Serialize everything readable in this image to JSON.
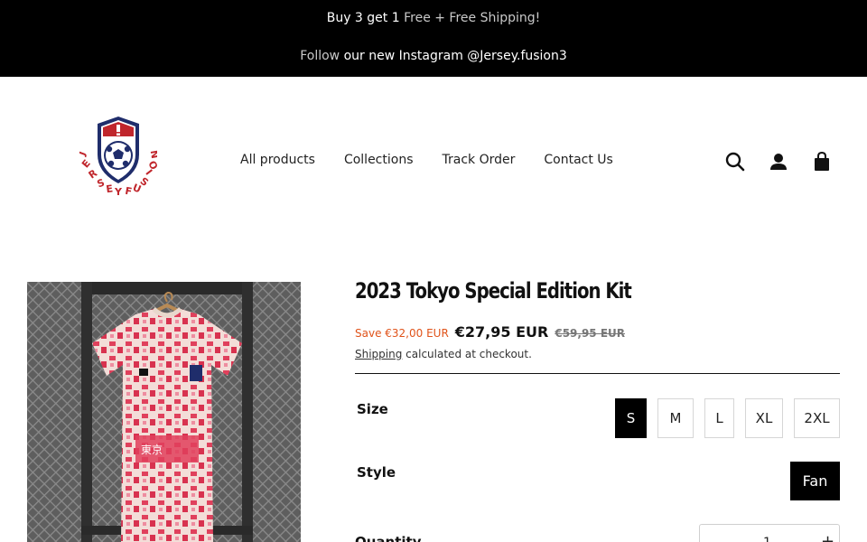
{
  "announcement": {
    "line1": {
      "a": "Buy 3 get 1 ",
      "b": "Free + Free Shipping!"
    },
    "line2": {
      "a": "Follow ",
      "b": "our new Instagram @Jersey.fusion3"
    }
  },
  "logo": {
    "text": "JERSEY FUSION"
  },
  "nav": {
    "items": [
      "All products",
      "Collections",
      "Track Order",
      "Contact Us"
    ]
  },
  "header_icons": [
    "search-icon",
    "account-icon",
    "cart-icon"
  ],
  "product": {
    "title": "2023 Tokyo Special Edition Kit",
    "save": "Save €32,00 EUR",
    "price": "€27,95 EUR",
    "compare_price": "€59,95 EUR",
    "shipping_link": "Shipping",
    "shipping_text": " calculated at checkout.",
    "size_label": "Size",
    "sizes": [
      "S",
      "M",
      "L",
      "XL",
      "2XL"
    ],
    "selected_size": "S",
    "style_label": "Style",
    "style_value": "Fan",
    "quantity_label": "Quantity",
    "quantity": "1",
    "plus": "+"
  },
  "colors": {
    "accent_save": "#e0531a",
    "announcement_bg": "#000000",
    "logo_red": "#c0262c",
    "logo_navy": "#1f2d6b"
  }
}
